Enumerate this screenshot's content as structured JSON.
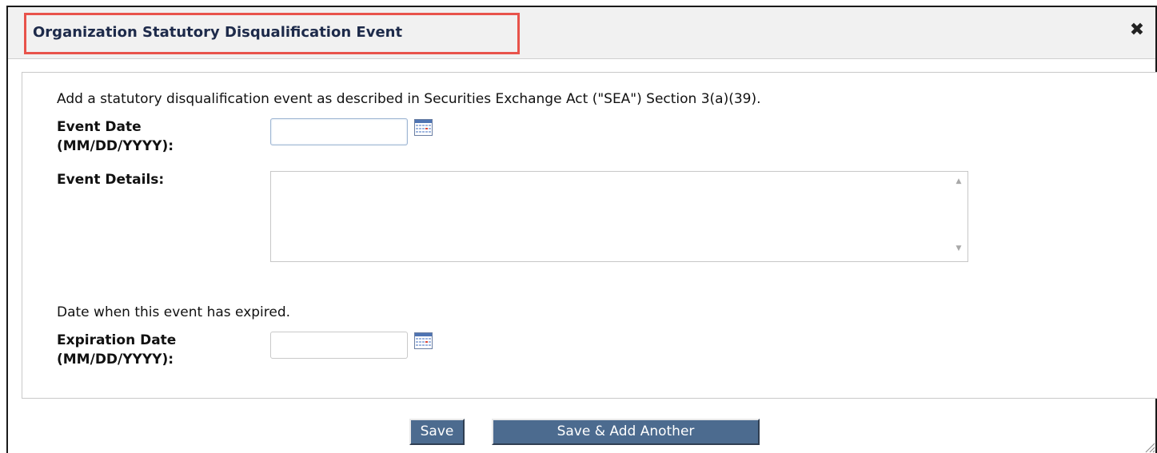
{
  "dialog": {
    "title": "Organization Statutory Disqualification Event",
    "close_icon": "close-icon"
  },
  "form": {
    "intro": "Add a statutory disqualification event as described in Securities Exchange Act (\"SEA\") Section 3(a)(39).",
    "event_date_label_line1": "Event Date",
    "event_date_label_line2": "(MM/DD/YYYY):",
    "event_date_value": "",
    "event_details_label": "Event Details:",
    "event_details_value": "",
    "expiration_intro": "Date when this event has expired.",
    "expiration_date_label_line1": "Expiration Date",
    "expiration_date_label_line2": "(MM/DD/YYYY):",
    "expiration_date_value": "",
    "calendar_icon": "calendar-icon"
  },
  "buttons": {
    "save": "Save",
    "save_add_another": "Save & Add Another"
  },
  "colors": {
    "title_highlight": "#e8534b",
    "button_bg": "#4c6b8f",
    "title_text": "#1d2a4a"
  }
}
